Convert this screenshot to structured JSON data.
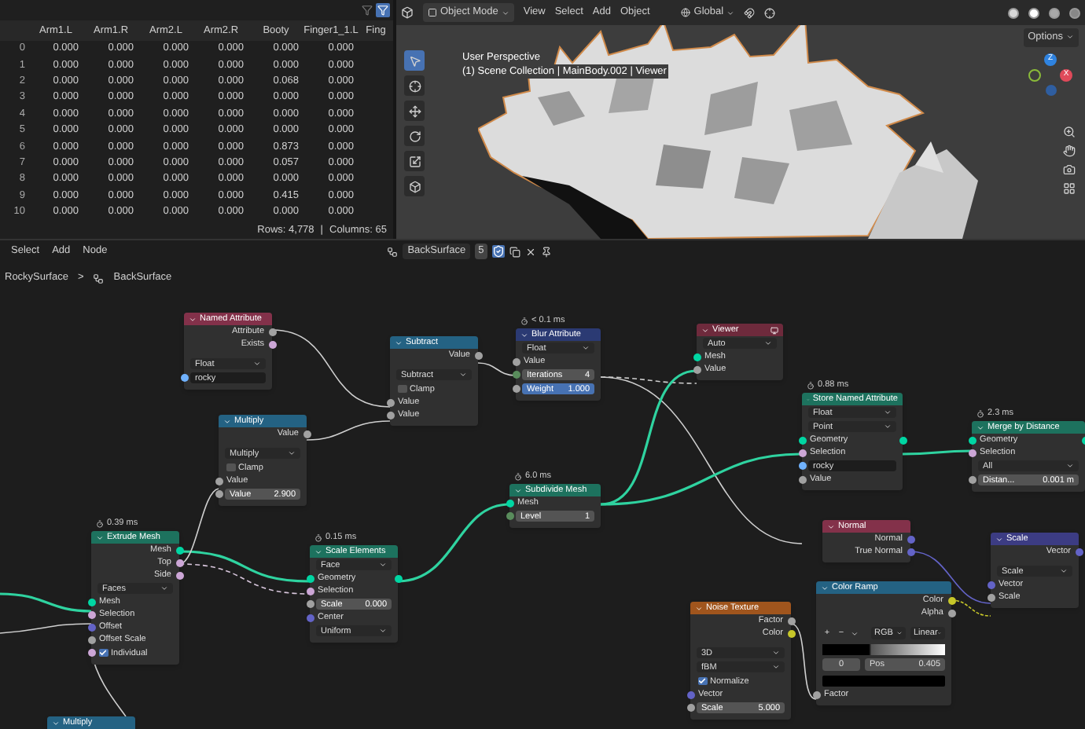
{
  "spreadsheet": {
    "columns": [
      "",
      "Arm1.L",
      "Arm1.R",
      "Arm2.L",
      "Arm2.R",
      "Booty",
      "Finger1_1.L",
      "Fing"
    ],
    "rows": [
      [
        "0",
        "0.000",
        "0.000",
        "0.000",
        "0.000",
        "0.000",
        "0.000"
      ],
      [
        "1",
        "0.000",
        "0.000",
        "0.000",
        "0.000",
        "0.000",
        "0.000"
      ],
      [
        "2",
        "0.000",
        "0.000",
        "0.000",
        "0.000",
        "0.068",
        "0.000"
      ],
      [
        "3",
        "0.000",
        "0.000",
        "0.000",
        "0.000",
        "0.000",
        "0.000"
      ],
      [
        "4",
        "0.000",
        "0.000",
        "0.000",
        "0.000",
        "0.000",
        "0.000"
      ],
      [
        "5",
        "0.000",
        "0.000",
        "0.000",
        "0.000",
        "0.000",
        "0.000"
      ],
      [
        "6",
        "0.000",
        "0.000",
        "0.000",
        "0.000",
        "0.873",
        "0.000"
      ],
      [
        "7",
        "0.000",
        "0.000",
        "0.000",
        "0.000",
        "0.057",
        "0.000"
      ],
      [
        "8",
        "0.000",
        "0.000",
        "0.000",
        "0.000",
        "0.000",
        "0.000"
      ],
      [
        "9",
        "0.000",
        "0.000",
        "0.000",
        "0.000",
        "0.415",
        "0.000"
      ],
      [
        "10",
        "0.000",
        "0.000",
        "0.000",
        "0.000",
        "0.000",
        "0.000"
      ]
    ],
    "rows_count": "Rows: 4,778",
    "separator": "|",
    "columns_count": "Columns: 65"
  },
  "viewport": {
    "mode": "Object Mode",
    "menus": [
      "View",
      "Select",
      "Add",
      "Object"
    ],
    "orientation": "Global",
    "options": "Options",
    "overlay": [
      "User Perspective",
      "(1) Scene Collection | MainBody.002 | Viewer"
    ],
    "gizmo_axes": [
      "Z",
      "X"
    ]
  },
  "node_editor": {
    "menus": [
      "Select",
      "Add",
      "Node"
    ],
    "tree_name": "BackSurface",
    "users": "5",
    "breadcrumb": [
      "RockySurface",
      ">",
      "BackSurface"
    ],
    "nodes": [
      {
        "title": "Named Attribute",
        "color": "#83314a",
        "rows": [
          {
            "kind": "output",
            "label": "Attribute",
            "color": "#a1a1a1"
          },
          {
            "kind": "output",
            "label": "Exists",
            "color": "#cca6d6"
          },
          {
            "kind": "gap"
          },
          {
            "kind": "dropdown",
            "label": "Float"
          },
          {
            "kind": "field",
            "value": "rocky",
            "color": "#70b2ff"
          }
        ]
      },
      {
        "title": "Subtract",
        "color": "#246283",
        "rows": [
          {
            "kind": "output",
            "label": "Value",
            "color": "#a1a1a1"
          },
          {
            "kind": "gap"
          },
          {
            "kind": "dropdown",
            "label": "Subtract"
          },
          {
            "kind": "checkbox",
            "label": "Clamp",
            "checked": false
          },
          {
            "kind": "input",
            "label": "Value",
            "color": "#a1a1a1"
          },
          {
            "kind": "input",
            "label": "Value",
            "color": "#a1a1a1"
          }
        ]
      },
      {
        "title": "Blur Attribute",
        "color": "#2b3a73",
        "timing": "< 0.1 ms",
        "rows": [
          {
            "kind": "dropdown",
            "label": "Float"
          },
          {
            "kind": "input",
            "label": "Value",
            "color": "#a1a1a1"
          },
          {
            "kind": "slider",
            "label": "Iterations",
            "value": "4",
            "color": "#598c5c"
          },
          {
            "kind": "slider",
            "label": "Weight",
            "value": "1.000",
            "color": "#a1a1a1",
            "level": 1
          }
        ]
      },
      {
        "title": "Viewer",
        "color": "#6e2a3c",
        "rows": [
          {
            "kind": "dropdown",
            "label": "Auto"
          },
          {
            "kind": "input",
            "label": "Mesh",
            "color": "#00d6a3"
          },
          {
            "kind": "input",
            "label": "Value",
            "color": "#a1a1a1"
          }
        ]
      },
      {
        "title": "Multiply",
        "color": "#246283",
        "rows": [
          {
            "kind": "output",
            "label": "Value",
            "color": "#a1a1a1"
          },
          {
            "kind": "gap"
          },
          {
            "kind": "dropdown",
            "label": "Multiply"
          },
          {
            "kind": "checkbox",
            "label": "Clamp",
            "checked": false
          },
          {
            "kind": "input",
            "label": "Value",
            "color": "#a1a1a1"
          },
          {
            "kind": "slider",
            "label": "Value",
            "value": "2.900",
            "color": "#a1a1a1"
          }
        ]
      },
      {
        "title": "Subdivide Mesh",
        "color": "#1d725e",
        "timing": "6.0 ms",
        "rows": [
          {
            "kind": "input",
            "label": "Mesh",
            "color": "#00d6a3"
          },
          {
            "kind": "slider",
            "label": "Level",
            "value": "1",
            "color": "#598c5c"
          }
        ]
      },
      {
        "title": "Store Named Attribute",
        "color": "#1d725e",
        "timing": "0.88 ms",
        "rows": [
          {
            "kind": "dropdown",
            "label": "Float"
          },
          {
            "kind": "dropdown",
            "label": "Point"
          },
          {
            "kind": "passthrough",
            "label": "Geometry",
            "color": "#00d6a3"
          },
          {
            "kind": "input",
            "label": "Selection",
            "color": "#cca6d6"
          },
          {
            "kind": "field",
            "value": "rocky",
            "color": "#70b2ff"
          },
          {
            "kind": "input",
            "label": "Value",
            "color": "#a1a1a1"
          }
        ]
      },
      {
        "title": "Merge by Distance",
        "color": "#1d725e",
        "timing": "2.3 ms",
        "rows": [
          {
            "kind": "passthrough",
            "label": "Geometry",
            "color": "#00d6a3"
          },
          {
            "kind": "input",
            "label": "Selection",
            "color": "#cca6d6"
          },
          {
            "kind": "dropdown",
            "label": "All"
          },
          {
            "kind": "slider",
            "label": "Distan...",
            "value": "0.001 m",
            "color": "#a1a1a1"
          }
        ]
      },
      {
        "title": "Extrude Mesh",
        "color": "#1d725e",
        "timing": "0.39 ms",
        "rows": [
          {
            "kind": "output",
            "label": "Mesh",
            "color": "#00d6a3"
          },
          {
            "kind": "output",
            "label": "Top",
            "color": "#cca6d6"
          },
          {
            "kind": "output",
            "label": "Side",
            "color": "#cca6d6"
          },
          {
            "kind": "dropdown",
            "label": "Faces"
          },
          {
            "kind": "input",
            "label": "Mesh",
            "color": "#00d6a3"
          },
          {
            "kind": "input",
            "label": "Selection",
            "color": "#cca6d6"
          },
          {
            "kind": "input",
            "label": "Offset",
            "color": "#6363c7"
          },
          {
            "kind": "input",
            "label": "Offset Scale",
            "color": "#a1a1a1"
          },
          {
            "kind": "checkbox",
            "label": "Individual",
            "checked": true,
            "color": "#cca6d6"
          }
        ]
      },
      {
        "title": "Scale Elements",
        "color": "#1d725e",
        "timing": "0.15 ms",
        "rows": [
          {
            "kind": "dropdown",
            "label": "Face"
          },
          {
            "kind": "passthrough",
            "label": "Geometry",
            "color": "#00d6a3"
          },
          {
            "kind": "input",
            "label": "Selection",
            "color": "#cca6d6"
          },
          {
            "kind": "slider",
            "label": "Scale",
            "value": "0.000",
            "color": "#a1a1a1"
          },
          {
            "kind": "input",
            "label": "Center",
            "color": "#6363c7"
          },
          {
            "kind": "dropdown",
            "label": "Uniform"
          }
        ]
      },
      {
        "title": "Normal",
        "color": "#83314a",
        "rows": [
          {
            "kind": "output",
            "label": "Normal",
            "color": "#6363c7"
          },
          {
            "kind": "output",
            "label": "True Normal",
            "color": "#6363c7"
          }
        ]
      },
      {
        "title": "Scale",
        "color": "#3c3c83",
        "rows": [
          {
            "kind": "output",
            "label": "Vector",
            "color": "#6363c7"
          },
          {
            "kind": "gap"
          },
          {
            "kind": "dropdown",
            "label": "Scale"
          },
          {
            "kind": "input",
            "label": "Vector",
            "color": "#6363c7"
          },
          {
            "kind": "input",
            "label": "Scale",
            "color": "#a1a1a1"
          }
        ]
      },
      {
        "title": "Color Ramp",
        "color": "#246283",
        "rows": [
          {
            "kind": "output",
            "label": "Color",
            "color": "#c7c729"
          },
          {
            "kind": "output",
            "label": "Alpha",
            "color": "#a1a1a1"
          },
          {
            "kind": "gap"
          },
          {
            "kind": "ramp_toolbar",
            "buttons": [
              "+",
              "−"
            ],
            "modes": [
              "RGB",
              "Linear"
            ]
          },
          {
            "kind": "gradient"
          },
          {
            "kind": "stop",
            "index": "0",
            "label": "Pos",
            "value": "0.405"
          },
          {
            "kind": "swatch"
          },
          {
            "kind": "input",
            "label": "Factor",
            "color": "#a1a1a1"
          }
        ]
      },
      {
        "title": "Noise Texture",
        "color": "#a0551d",
        "rows": [
          {
            "kind": "output",
            "label": "Factor",
            "color": "#a1a1a1"
          },
          {
            "kind": "output",
            "label": "Color",
            "color": "#c7c729"
          },
          {
            "kind": "gap"
          },
          {
            "kind": "dropdown",
            "label": "3D"
          },
          {
            "kind": "dropdown",
            "label": "fBM"
          },
          {
            "kind": "checkbox",
            "label": "Normalize",
            "checked": true
          },
          {
            "kind": "input",
            "label": "Vector",
            "color": "#6363c7"
          },
          {
            "kind": "slider",
            "label": "Scale",
            "value": "5.000",
            "color": "#a1a1a1"
          }
        ]
      },
      {
        "title": "Multiply",
        "color": "#246283"
      }
    ]
  }
}
